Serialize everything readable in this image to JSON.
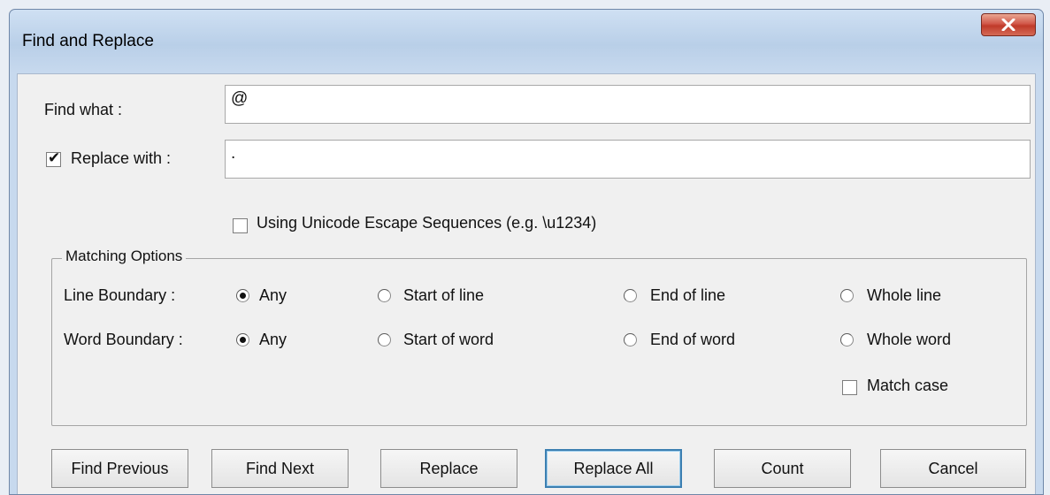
{
  "window": {
    "title": "Find and Replace"
  },
  "find": {
    "label": "Find what :",
    "value": "@"
  },
  "replace": {
    "label": "Replace with :",
    "value": ".",
    "checked": true
  },
  "unicode_option": {
    "label": "Using Unicode Escape Sequences (e.g. \\u1234)",
    "checked": false
  },
  "matching": {
    "title": "Matching Options",
    "line_boundary": {
      "label": "Line Boundary :",
      "options": [
        "Any",
        "Start of line",
        "End of line",
        "Whole line"
      ],
      "selected": "Any"
    },
    "word_boundary": {
      "label": "Word Boundary :",
      "options": [
        "Any",
        "Start of word",
        "End of word",
        "Whole word"
      ],
      "selected": "Any"
    },
    "match_case": {
      "label": "Match case",
      "checked": false
    }
  },
  "buttons": {
    "find_previous": "Find Previous",
    "find_next": "Find Next",
    "replace": "Replace",
    "replace_all": "Replace All",
    "count": "Count",
    "cancel": "Cancel"
  },
  "icons": {
    "close": "close-icon"
  }
}
